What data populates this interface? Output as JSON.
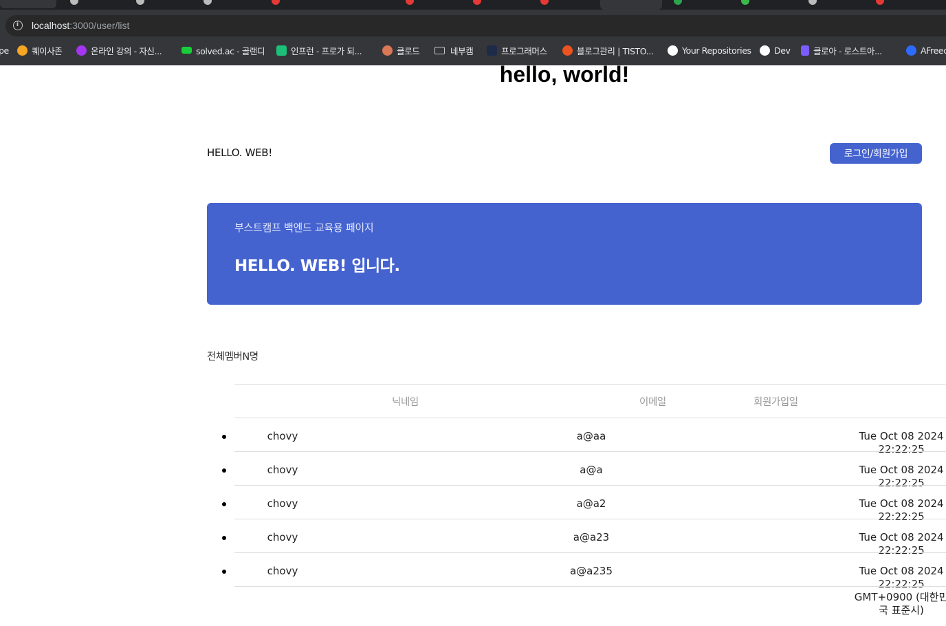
{
  "browser": {
    "url_host": "localhost",
    "url_path": ":3000/user/list",
    "bookmarks": [
      {
        "label": "pe",
        "icon": "partial-icon",
        "color": "#35363a"
      },
      {
        "label": "퀘이사존",
        "icon": "quasarzone-icon",
        "color": "#f5a623"
      },
      {
        "label": "온라인 강의 - 자신...",
        "icon": "udemy-icon",
        "color": "#a435f0"
      },
      {
        "label": "solved.ac - 골랜디",
        "icon": "solvedac-icon",
        "color": "#17ce3a"
      },
      {
        "label": "인프런 - 프로가 되...",
        "icon": "inflearn-icon",
        "color": "#1dc078"
      },
      {
        "label": "클로드",
        "icon": "claude-icon",
        "color": "#d97757"
      },
      {
        "label": "네부캠",
        "icon": "folder-icon",
        "color": "#c8c8c8"
      },
      {
        "label": "프로그래머스",
        "icon": "programmers-icon",
        "color": "#1e2a4a"
      },
      {
        "label": "블로그관리 | TISTO...",
        "icon": "tistory-icon",
        "color": "#eb531f"
      },
      {
        "label": "Your Repositories",
        "icon": "github-icon",
        "color": "#ffffff"
      },
      {
        "label": "Dev",
        "icon": "chatgpt-icon",
        "color": "#ffffff"
      },
      {
        "label": "클로아 - 로스트아...",
        "icon": "kloa-icon",
        "color": "#7c5cff"
      },
      {
        "label": "AFreec",
        "icon": "afreeca-icon",
        "color": "#2d6bff"
      }
    ]
  },
  "page": {
    "title": "hello, world!",
    "brand": "HELLO. WEB!",
    "login_button": "로그인/회원가입",
    "hero_subtitle": "부스트캠프 백엔드 교육용 페이지",
    "hero_title": "HELLO. WEB! 입니다.",
    "member_count": "전체멤버N명",
    "accent_color": "#4563cf"
  },
  "table": {
    "headers": [
      "닉네임",
      "이메일",
      "회원가입일"
    ],
    "rows": [
      {
        "nickname": "chovy",
        "email": "a@aa",
        "joined": "Tue Oct 08 2024 22:22:25"
      },
      {
        "nickname": "chovy",
        "email": "a@a",
        "joined": "Tue Oct 08 2024 22:22:25"
      },
      {
        "nickname": "chovy",
        "email": "a@a2",
        "joined": "Tue Oct 08 2024 22:22:25"
      },
      {
        "nickname": "chovy",
        "email": "a@a23",
        "joined": "Tue Oct 08 2024 22:22:25"
      },
      {
        "nickname": "chovy",
        "email": "a@a235",
        "joined": "Tue Oct 08 2024 22:22:25 GMT+0900 (대한민국 표준시)"
      }
    ]
  }
}
